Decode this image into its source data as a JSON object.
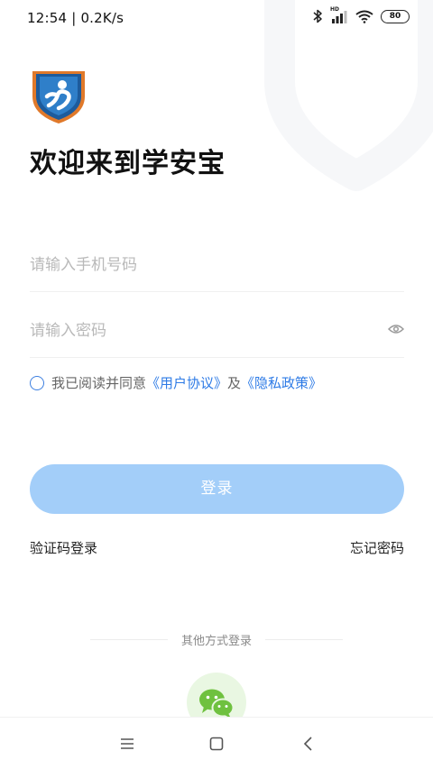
{
  "status_bar": {
    "time": "12:54",
    "separator": "|",
    "speed": "0.2K/s",
    "battery": "80",
    "hd_label": "HD"
  },
  "header": {
    "welcome": "欢迎来到学安宝"
  },
  "form": {
    "phone_placeholder": "请输入手机号码",
    "password_placeholder": "请输入密码"
  },
  "agreement": {
    "prefix": "我已阅读并同意",
    "user_agreement": "《用户协议》",
    "connector": "及",
    "privacy_policy": "《隐私政策》"
  },
  "actions": {
    "login": "登录",
    "sms_login": "验证码登录",
    "forgot_password": "忘记密码"
  },
  "other_login": {
    "label": "其他方式登录",
    "methods": [
      "wechat-icon"
    ]
  },
  "colors": {
    "accent": "#2e7be6",
    "login_button": "#a3cef9",
    "wechat_green": "#7bcb4a",
    "wechat_bg": "#e9f7e2"
  }
}
